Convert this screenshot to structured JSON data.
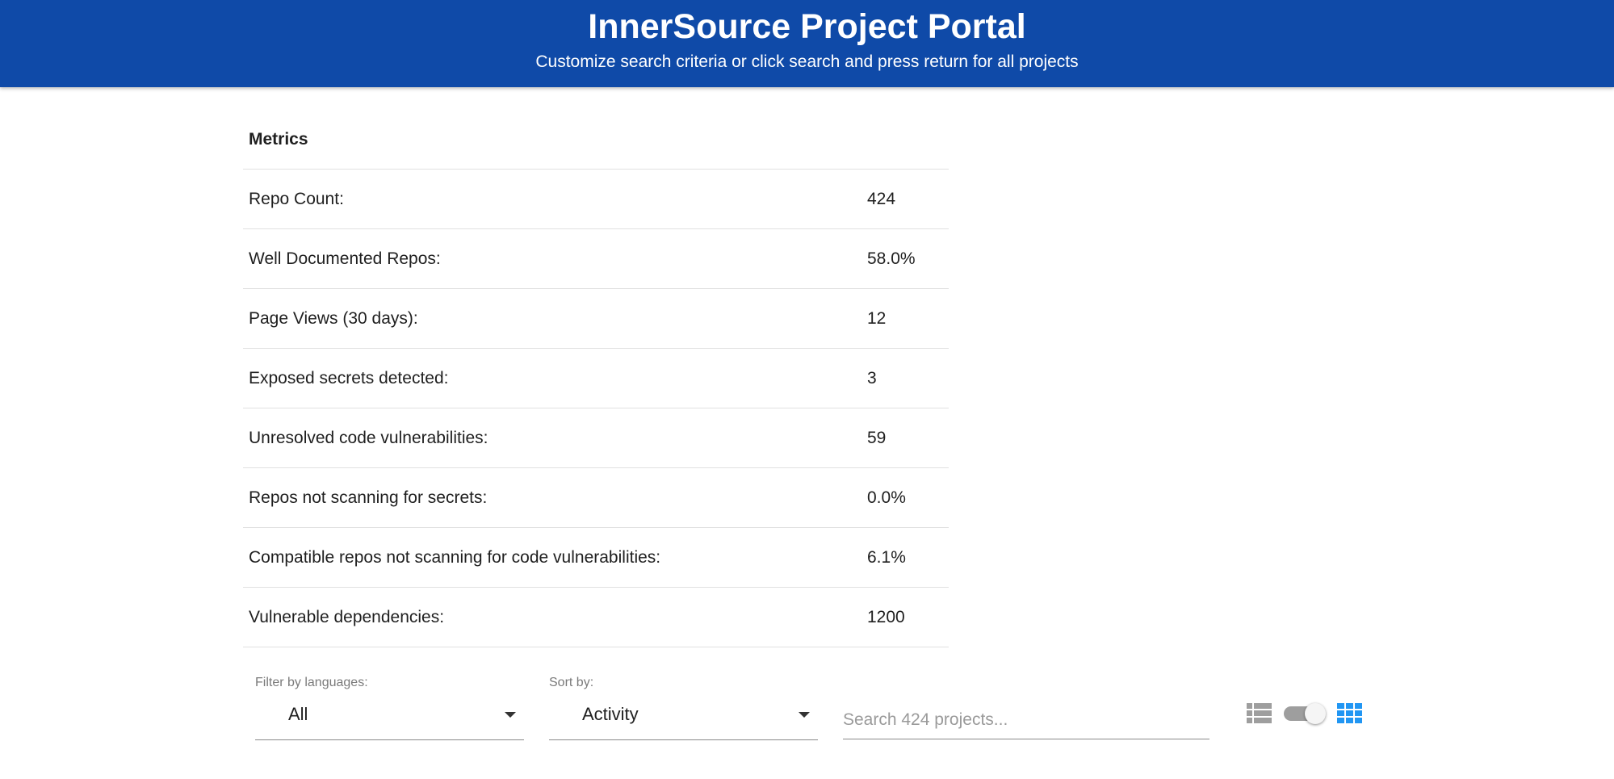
{
  "header": {
    "title": "InnerSource Project Portal",
    "subtitle": "Customize search criteria or click search and press return for all projects"
  },
  "metrics": {
    "heading": "Metrics",
    "rows": [
      {
        "label": "Repo Count:",
        "value": "424"
      },
      {
        "label": "Well Documented Repos:",
        "value": "58.0%"
      },
      {
        "label": "Page Views (30 days):",
        "value": "12"
      },
      {
        "label": "Exposed secrets detected:",
        "value": "3"
      },
      {
        "label": "Unresolved code vulnerabilities:",
        "value": "59"
      },
      {
        "label": "Repos not scanning for secrets:",
        "value": "0.0%"
      },
      {
        "label": "Compatible repos not scanning for code vulnerabilities:",
        "value": "6.1%"
      },
      {
        "label": "Vulnerable dependencies:",
        "value": "1200"
      }
    ]
  },
  "filters": {
    "language": {
      "label": "Filter by languages:",
      "value": "All"
    },
    "sort": {
      "label": "Sort by:",
      "value": "Activity"
    },
    "search": {
      "placeholder": "Search 424 projects...",
      "value": ""
    }
  },
  "view_toggle": {
    "list_icon": "list-view-icon",
    "grid_icon": "grid-view-icon",
    "grid_active": true,
    "inactive_color": "#9e9e9e",
    "active_color": "#2196f3"
  },
  "colors": {
    "header_bg": "#0f4aa8",
    "header_text": "#ffffff"
  }
}
